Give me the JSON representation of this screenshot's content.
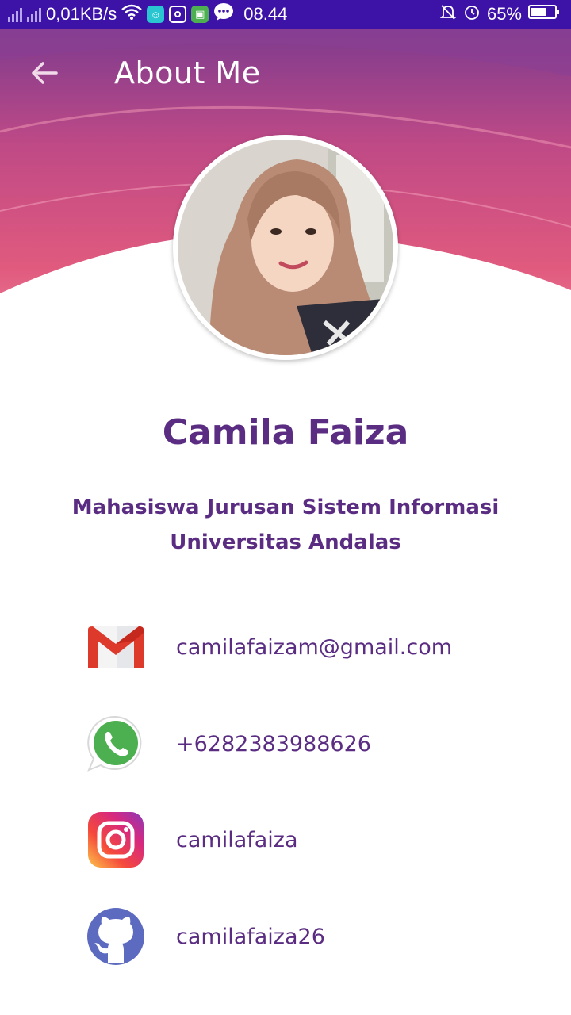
{
  "status_bar": {
    "network_speed": "0,01KB/s",
    "time": "08.44",
    "battery": "65%"
  },
  "header": {
    "title": "About Me",
    "back_icon": "arrow-left-icon",
    "gradient_colors": [
      "#7e3b8e",
      "#e05a7e",
      "#f28aa4"
    ]
  },
  "profile": {
    "name": "Camila Faiza",
    "subtitle_line1": "Mahasiswa Jurusan Sistem Informasi",
    "subtitle_line2": "Universitas Andalas"
  },
  "contacts": [
    {
      "icon": "gmail-icon",
      "text": "camilafaizam@gmail.com"
    },
    {
      "icon": "whatsapp-icon",
      "text": "+6282383988626"
    },
    {
      "icon": "instagram-icon",
      "text": "camilafaiza"
    },
    {
      "icon": "github-icon",
      "text": "camilafaiza26"
    }
  ],
  "colors": {
    "status_bar": "#3d12a6",
    "text_primary": "#5b2d82"
  }
}
